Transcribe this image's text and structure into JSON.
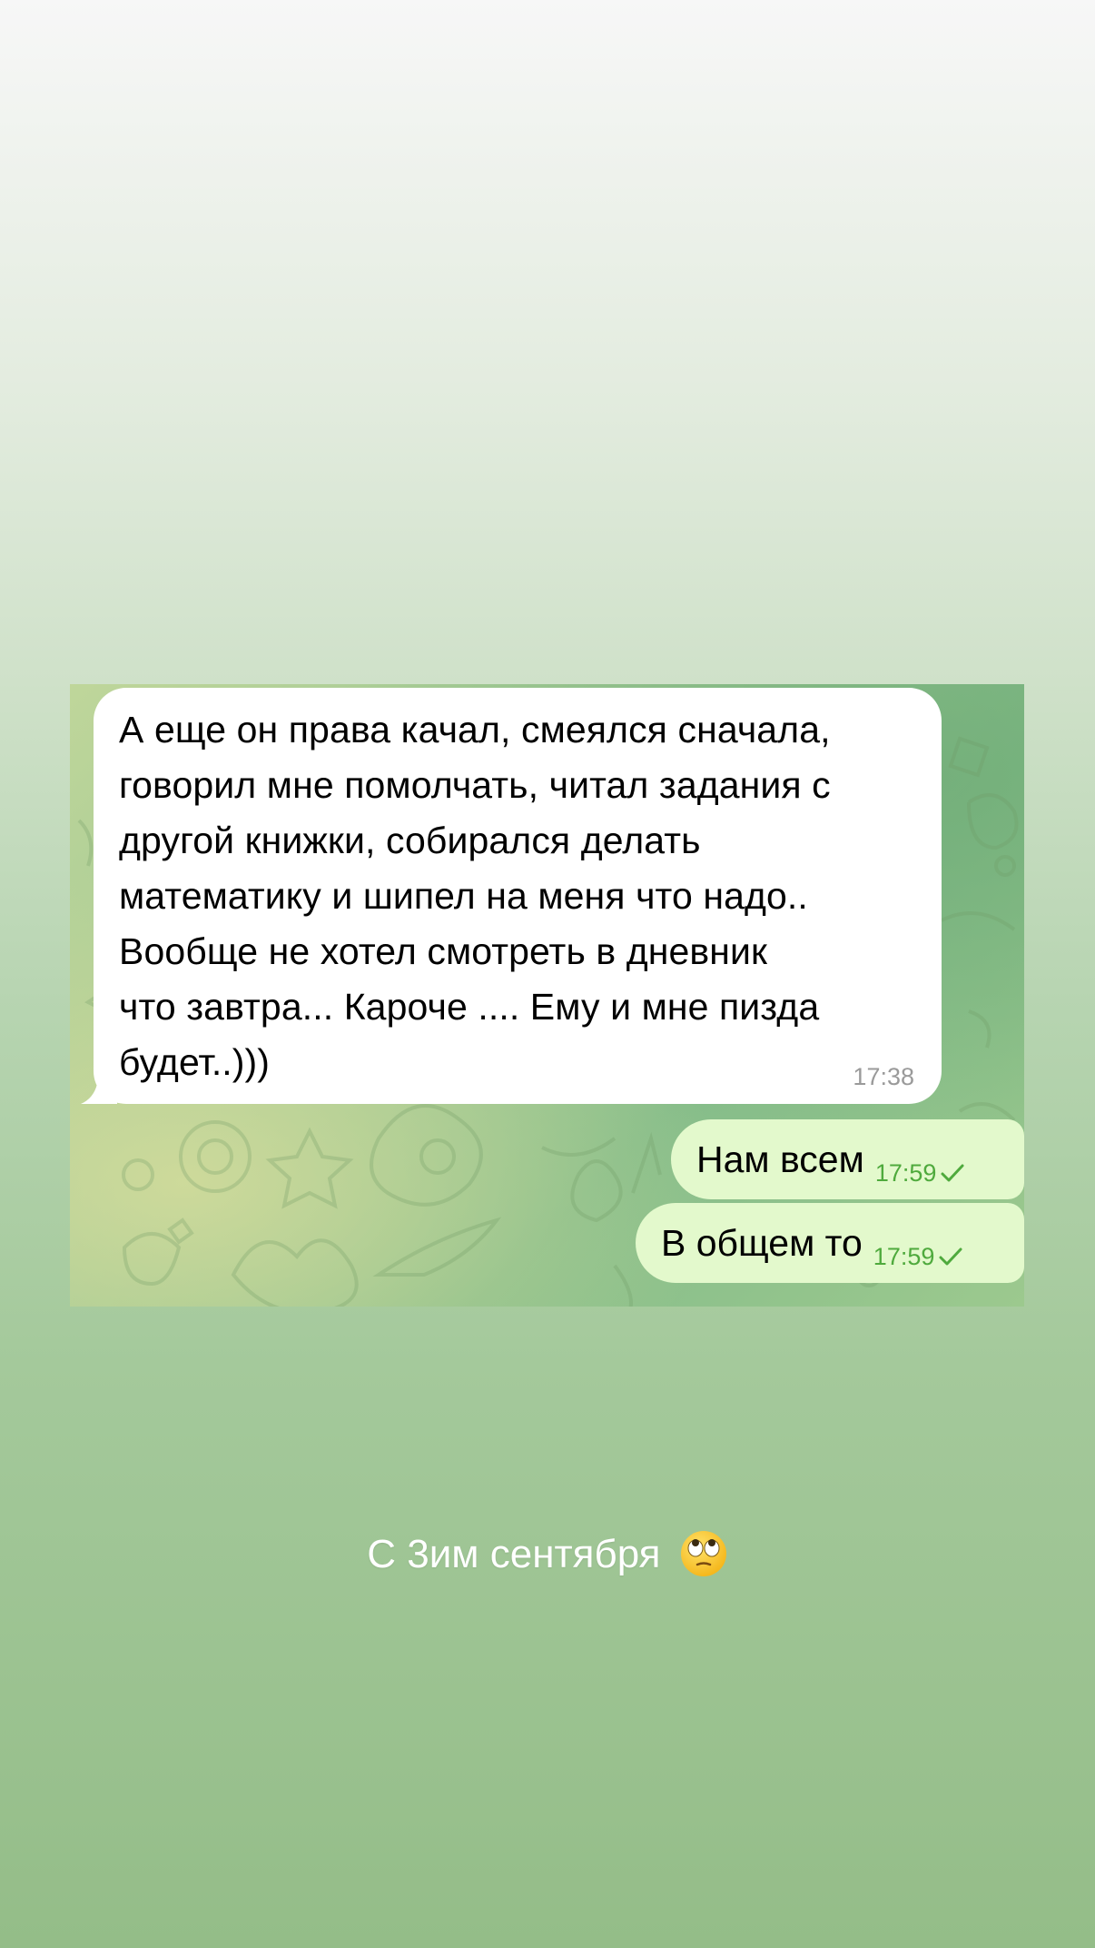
{
  "messages": [
    {
      "direction": "incoming",
      "text": "А еще он права качал, смеялся сначала,\nговорил мне помолчать, читал задания с\nдругой книжки, собирался делать\nматематику и шипел на меня что надо..\nВообще не хотел смотреть в дневник\nчто завтра... Кароче .... Ему и мне пизда\nбудет..)))",
      "time": "17:38"
    },
    {
      "direction": "outgoing",
      "text": "Нам всем",
      "time": "17:59",
      "status": "sent-check-icon"
    },
    {
      "direction": "outgoing",
      "text": "В общем то",
      "time": "17:59",
      "status": "sent-check-icon"
    }
  ],
  "caption": {
    "text": "С 3им сентября",
    "emoji": "face-with-rolling-eyes"
  },
  "colors": {
    "incoming_bubble": "#ffffff",
    "outgoing_bubble": "#e3f9cc",
    "outgoing_meta": "#4faa3d",
    "incoming_time": "#9a9a9a",
    "caption": "#ffffff"
  }
}
